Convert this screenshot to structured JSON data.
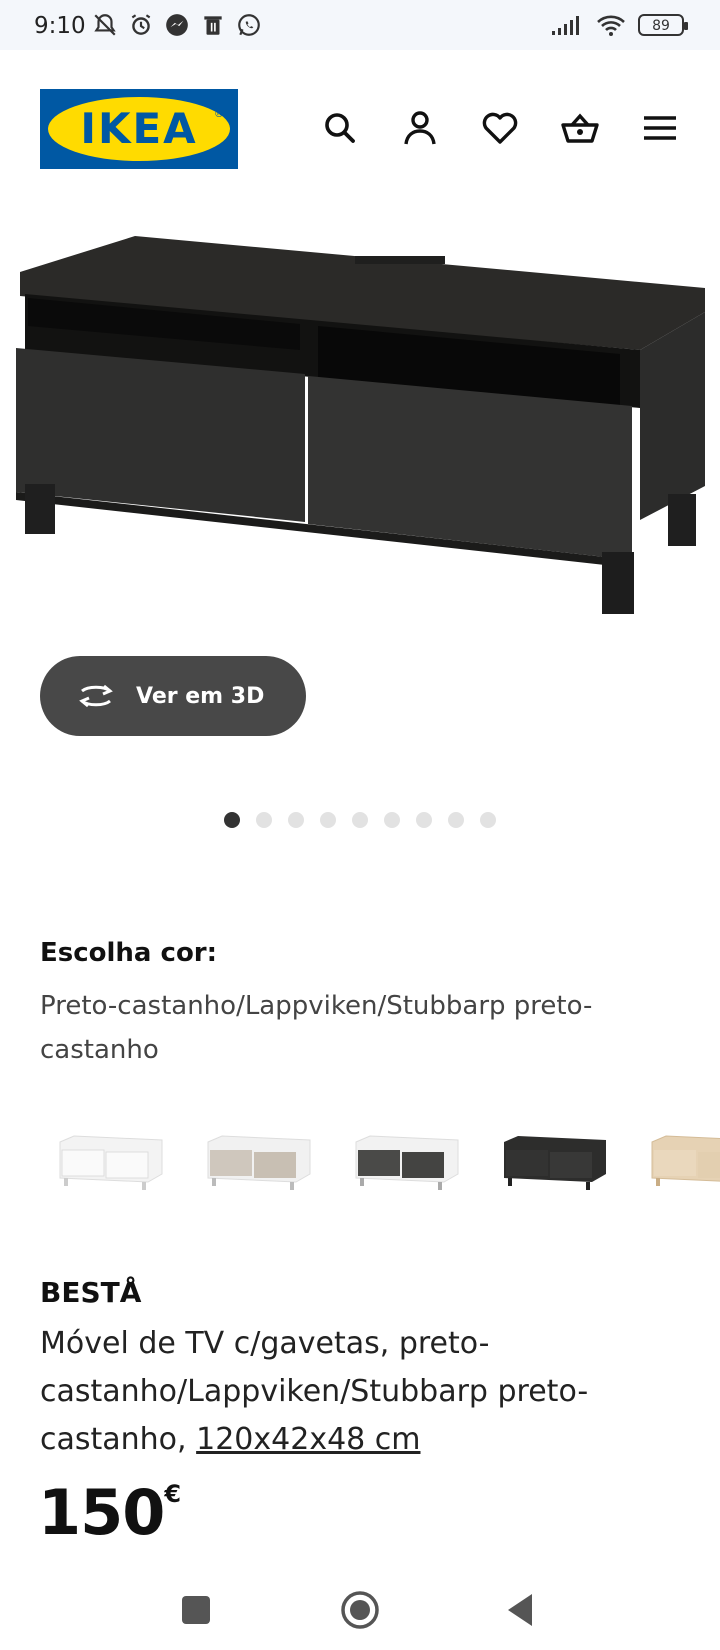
{
  "status_bar": {
    "time": "9:10",
    "battery": "89"
  },
  "header": {
    "logo_text": "IKEA"
  },
  "product_image": {
    "view_3d_label": "Ver em 3D",
    "carousel_count": 9,
    "carousel_active": 0
  },
  "color": {
    "label": "Escolha cor:",
    "selected": "Preto-castanho/Lappviken/Stubbarp preto-castanho"
  },
  "product": {
    "name": "BESTÅ",
    "description": "Móvel de TV c/gavetas, preto-castanho/Lappviken/Stubbarp preto-castanho,",
    "dimensions": "120x42x48 cm",
    "price_value": "150",
    "price_currency": "€"
  },
  "colors": {
    "accent_blue": "#0058a3",
    "accent_yellow": "#ffdb00",
    "button_dark": "#484848"
  }
}
